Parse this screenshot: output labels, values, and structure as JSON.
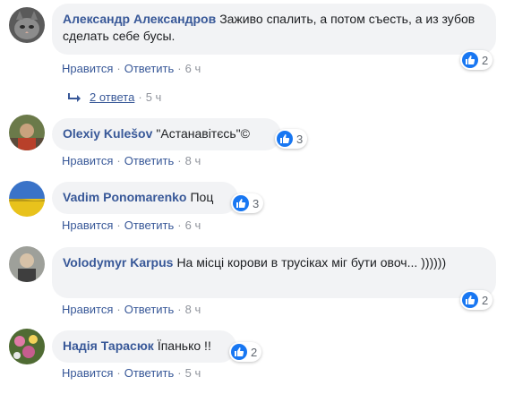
{
  "labels": {
    "like": "Нравится",
    "reply": "Ответить",
    "dot": "·"
  },
  "comments": [
    {
      "author": "Александр Александров",
      "text": "Заживо спалить, а потом съесть, а из зубов сделать себе бусы.",
      "time": "6 ч",
      "likes": "2"
    },
    {
      "author": "Olexiy Kulešov",
      "text": "\"Астанавітєсь\"©",
      "time": "8 ч",
      "likes": "3"
    },
    {
      "author": "Vadim Ponomarenko",
      "text": "Поц",
      "time": "6 ч",
      "likes": "3"
    },
    {
      "author": "Volodymyr Karpus",
      "text": "На місці корови в трусіках міг бути овоч... ))))))",
      "time": "8 ч",
      "likes": "2"
    },
    {
      "author": "Надія Тарасюк",
      "text": "Їпанько !!",
      "time": "5 ч",
      "likes": "2"
    }
  ],
  "replies": {
    "label": "2 ответа",
    "time": "5 ч"
  },
  "icons": {
    "reply_arrow": "reply-arrow-icon",
    "like": "like-thumb-icon"
  },
  "colors": {
    "link": "#385898",
    "bubble": "#f2f3f5",
    "like_blue": "#1877f2",
    "meta": "#606770"
  }
}
